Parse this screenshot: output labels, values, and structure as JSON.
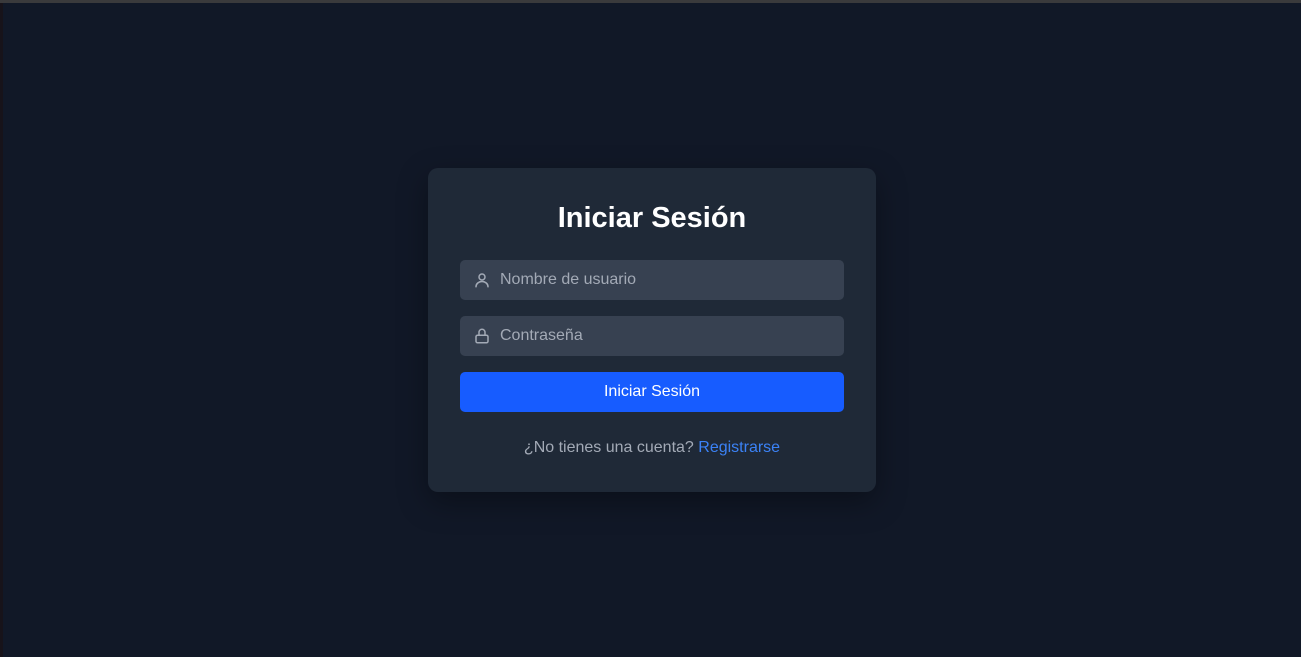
{
  "login": {
    "title": "Iniciar Sesión",
    "username": {
      "placeholder": "Nombre de usuario",
      "value": "",
      "icon": "user-icon"
    },
    "password": {
      "placeholder": "Contraseña",
      "value": "",
      "icon": "lock-icon"
    },
    "submit_label": "Iniciar Sesión",
    "footer_text": "¿No tienes una cuenta?",
    "register_link": "Registrarse"
  },
  "colors": {
    "background": "#111827",
    "card": "#1f2937",
    "input": "#374151",
    "primary": "#175cff",
    "link": "#3b82f6"
  }
}
